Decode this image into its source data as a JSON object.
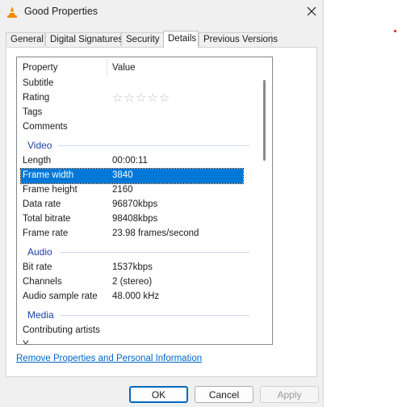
{
  "window": {
    "title": "Good Properties",
    "app_icon": "vlc-cone-icon",
    "close_icon": "close-icon"
  },
  "tabs": [
    {
      "label": "General"
    },
    {
      "label": "Digital Signatures"
    },
    {
      "label": "Security"
    },
    {
      "label": "Details",
      "active": true
    },
    {
      "label": "Previous Versions"
    }
  ],
  "details": {
    "header": {
      "property": "Property",
      "value": "Value"
    },
    "top_rows": [
      {
        "key": "Subtitle",
        "value": ""
      },
      {
        "key": "Rating",
        "value": "",
        "stars": 0,
        "stars_max": 5
      },
      {
        "key": "Tags",
        "value": ""
      },
      {
        "key": "Comments",
        "value": ""
      }
    ],
    "groups": {
      "video": {
        "label": "Video",
        "rows": [
          {
            "key": "Length",
            "value": "00:00:11"
          },
          {
            "key": "Frame width",
            "value": "3840",
            "selected": true
          },
          {
            "key": "Frame height",
            "value": "2160"
          },
          {
            "key": "Data rate",
            "value": "96870kbps"
          },
          {
            "key": "Total bitrate",
            "value": "98408kbps"
          },
          {
            "key": "Frame rate",
            "value": "23.98 frames/second"
          }
        ]
      },
      "audio": {
        "label": "Audio",
        "rows": [
          {
            "key": "Bit rate",
            "value": "1537kbps"
          },
          {
            "key": "Channels",
            "value": "2 (stereo)"
          },
          {
            "key": "Audio sample rate",
            "value": "48.000 kHz"
          }
        ]
      },
      "media": {
        "label": "Media",
        "rows": [
          {
            "key": "Contributing artists",
            "value": ""
          },
          {
            "key": "Y",
            "value": ""
          }
        ]
      }
    }
  },
  "remove_link": "Remove Properties and Personal Information",
  "buttons": {
    "ok": "OK",
    "cancel": "Cancel",
    "apply": "Apply"
  },
  "colors": {
    "selection": "#0078d7",
    "group_header": "#1a3fa8",
    "link": "#0066cc"
  }
}
